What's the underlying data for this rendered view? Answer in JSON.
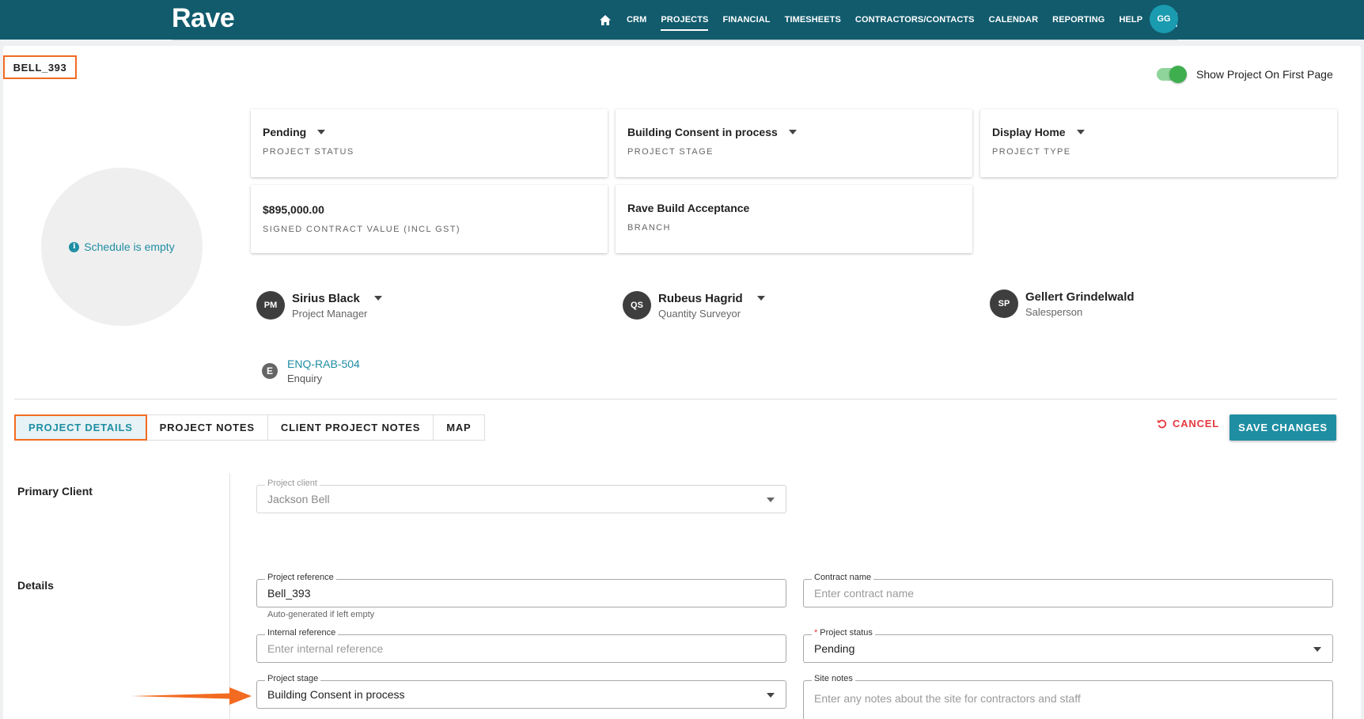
{
  "app": {
    "logo": "Rave"
  },
  "nav": {
    "items": [
      {
        "label": "CRM"
      },
      {
        "label": "PROJECTS"
      },
      {
        "label": "FINANCIAL"
      },
      {
        "label": "TIMESHEETS"
      },
      {
        "label": "CONTRACTORS/CONTACTS"
      },
      {
        "label": "CALENDAR"
      },
      {
        "label": "REPORTING"
      },
      {
        "label": "HELP"
      }
    ],
    "active": "PROJECTS",
    "user_initials": "GG"
  },
  "project": {
    "reference_badge": "BELL_393",
    "show_on_first_page_label": "Show Project On First Page",
    "show_on_first_page": true,
    "schedule_text": "Schedule is empty"
  },
  "tiles": {
    "status": {
      "value": "Pending",
      "label": "PROJECT STATUS"
    },
    "stage": {
      "value": "Building Consent in process",
      "label": "PROJECT STAGE"
    },
    "type": {
      "value": "Display Home",
      "label": "PROJECT TYPE"
    },
    "contract_value": {
      "value": "$895,000.00",
      "label": "SIGNED CONTRACT VALUE (INCL GST)"
    },
    "branch": {
      "value": "Rave Build Acceptance",
      "label": "BRANCH"
    }
  },
  "people": {
    "pm": {
      "initials": "PM",
      "name": "Sirius Black",
      "role": "Project Manager"
    },
    "qs": {
      "initials": "QS",
      "name": "Rubeus Hagrid",
      "role": "Quantity Surveyor"
    },
    "sp": {
      "initials": "SP",
      "name": "Gellert Grindelwald",
      "role": "Salesperson"
    }
  },
  "enquiry": {
    "badge": "E",
    "link": "ENQ-RAB-504",
    "label": "Enquiry"
  },
  "tabs": [
    {
      "label": "PROJECT DETAILS"
    },
    {
      "label": "PROJECT NOTES"
    },
    {
      "label": "CLIENT PROJECT NOTES"
    },
    {
      "label": "MAP"
    }
  ],
  "actions": {
    "cancel": "CANCEL",
    "save": "SAVE CHANGES"
  },
  "form": {
    "primary_client_title": "Primary Client",
    "details_title": "Details",
    "project_client": {
      "label": "Project client",
      "value": "Jackson Bell"
    },
    "project_reference": {
      "label": "Project reference",
      "value": "Bell_393",
      "helper": "Auto-generated if left empty"
    },
    "contract_name": {
      "label": "Contract name",
      "placeholder": "Enter contract name"
    },
    "internal_reference": {
      "label": "Internal reference",
      "placeholder": "Enter internal reference"
    },
    "project_status": {
      "label": "Project status",
      "required_mark": "*",
      "value": "Pending"
    },
    "project_stage": {
      "label": "Project stage",
      "value": "Building Consent in process"
    },
    "site_notes": {
      "label": "Site notes",
      "placeholder": "Enter any notes about the site for contractors and staff"
    }
  },
  "colors": {
    "topbar": "#115b6d",
    "accent": "#1f8ea3",
    "highlight_outline": "#f26b21",
    "cancel": "#e5393f",
    "toggle_on": "#3fae4f"
  }
}
